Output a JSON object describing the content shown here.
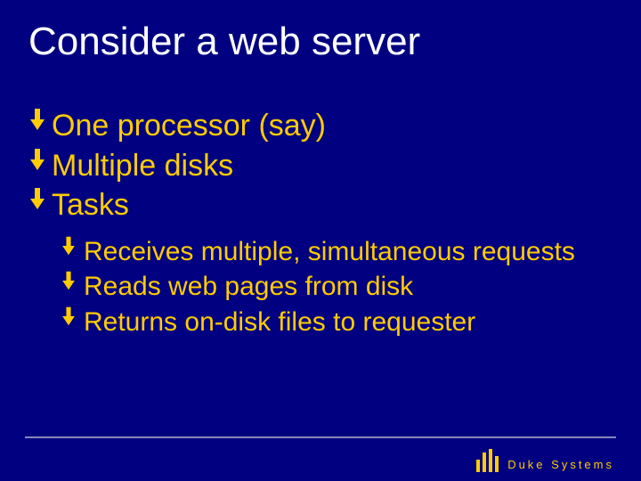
{
  "title": "Consider a web server",
  "bullets_l1": [
    "One processor (say)",
    "Multiple disks",
    "Tasks"
  ],
  "bullets_l2": [
    "Receives multiple, simultaneous requests",
    "Reads web pages from disk",
    "Returns on-disk files to requester"
  ],
  "footer_brand": "Duke Systems"
}
